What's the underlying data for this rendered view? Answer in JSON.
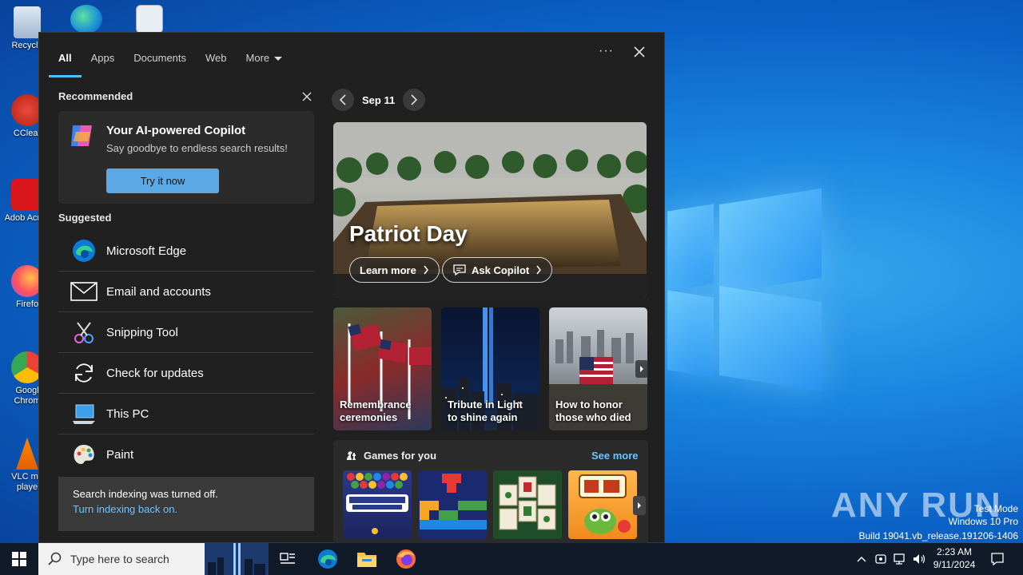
{
  "desktop": {
    "icons": [
      {
        "label": "Recycle"
      },
      {
        "label": "CClear"
      },
      {
        "label": "Adob Acrob"
      },
      {
        "label": "Firefo"
      },
      {
        "label": "Googl Chrom"
      },
      {
        "label": "VLC me playe"
      }
    ],
    "watermark": "ANY RUN",
    "build": {
      "line1": "Test Mode",
      "line2": "Windows 10 Pro",
      "line3": "Build 19041.vb_release.191206-1406"
    }
  },
  "panel": {
    "tabs": [
      {
        "label": "All"
      },
      {
        "label": "Apps"
      },
      {
        "label": "Documents"
      },
      {
        "label": "Web"
      },
      {
        "label": "More"
      }
    ],
    "more_dots": "···",
    "recommended": {
      "title": "Recommended",
      "card_title": "Your AI-powered Copilot",
      "card_sub": "Say goodbye to endless search results!",
      "button": "Try it now"
    },
    "suggested": {
      "title": "Suggested",
      "items": [
        {
          "label": "Microsoft Edge",
          "icon": "edge-icon"
        },
        {
          "label": "Email and accounts",
          "icon": "mail-icon"
        },
        {
          "label": "Snipping Tool",
          "icon": "scissors-icon"
        },
        {
          "label": "Check for updates",
          "icon": "refresh-icon"
        },
        {
          "label": "This PC",
          "icon": "computer-icon"
        },
        {
          "label": "Paint",
          "icon": "palette-icon"
        }
      ]
    },
    "indexing": {
      "text": "Search indexing was turned off.",
      "link": "Turn indexing back on."
    },
    "highlights": {
      "date": "Sep 11",
      "hero_title": "Patriot Day",
      "learn_more": "Learn more",
      "ask_copilot": "Ask Copilot",
      "cards": [
        {
          "caption": "Remembrance ceremonies"
        },
        {
          "caption": "Tribute in Light to shine again"
        },
        {
          "caption": "How to honor those who died"
        }
      ],
      "games_title": "Games for you",
      "see_more": "See more"
    }
  },
  "taskbar": {
    "search_placeholder": "Type here to search",
    "time": "2:23 AM",
    "date": "9/11/2024"
  }
}
